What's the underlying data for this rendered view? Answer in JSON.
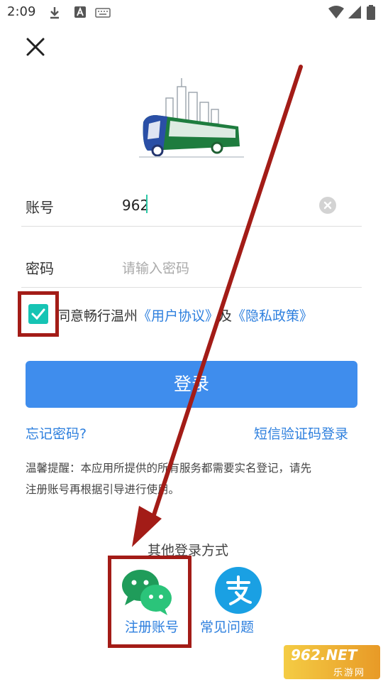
{
  "status_bar": {
    "time": "2:09",
    "icons": [
      "download-icon",
      "a-box-icon",
      "keyboard-icon",
      "wifi-icon",
      "signal-icon",
      "battery-icon"
    ]
  },
  "close_icon": "close-icon",
  "form": {
    "account_label": "账号",
    "account_value": "962",
    "password_label": "密码",
    "password_placeholder": "请输入密码"
  },
  "agreement": {
    "prefix": "同意畅行温州",
    "user_agreement": "《用户协议》",
    "and": "及",
    "privacy_policy": "《隐私政策》",
    "checked": true
  },
  "login_button": "登录",
  "links": {
    "forgot_password": "忘记密码?",
    "sms_login": "短信验证码登录"
  },
  "notice": {
    "line1": "温馨提醒：本应用所提供的所有服务都需要实名登记，请先",
    "line2": "注册账号再根据引导进行使用。"
  },
  "other_login": {
    "title": "其他登录方式",
    "wechat_label": "注册账号",
    "faq_label": "常见问题"
  },
  "watermark": {
    "top": "962.NET",
    "bottom": "乐游网"
  },
  "colors": {
    "primary": "#3f8ded",
    "link": "#2d7fde",
    "checkbox": "#16c4b4",
    "wechat": "#2bc47a",
    "alipay": "#1aa0e3",
    "annotation": "#a31c17"
  }
}
